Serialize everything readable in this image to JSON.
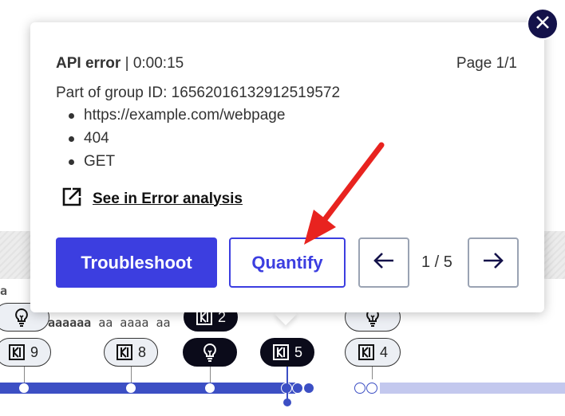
{
  "popup": {
    "error_type": "API error",
    "separator": " | ",
    "duration": "0:00:15",
    "page_indicator": "Page 1/1",
    "group_id": "Part of group ID: 16562016132912519572",
    "details": [
      "https://example.com/webpage",
      "404",
      "GET"
    ],
    "link_label": "See in Error analysis",
    "troubleshoot_label": "Troubleshoot",
    "quantify_label": "Quantify",
    "counter": "1 / 5"
  },
  "background": {
    "text_a": "a",
    "row_text_bold": "aaaaaa",
    "row_text_rest": " aa aaaa aa",
    "pills": [
      {
        "id": "9",
        "label": "9",
        "icon": "frames-icon",
        "dark": false
      },
      {
        "id": "8",
        "label": "8",
        "icon": "frames-icon",
        "dark": false
      },
      {
        "id": "bulb-dark",
        "label": "",
        "icon": "lightbulb-icon",
        "dark": true
      },
      {
        "id": "5",
        "label": "5",
        "icon": "frames-icon",
        "dark": true
      },
      {
        "id": "4",
        "label": "4",
        "icon": "frames-icon",
        "dark": false
      },
      {
        "id": "2",
        "label": "2",
        "icon": "frames-icon",
        "dark": true
      },
      {
        "id": "bulb-left",
        "label": "",
        "icon": "lightbulb-icon",
        "dark": false
      },
      {
        "id": "bulb-right",
        "label": "",
        "icon": "lightbulb-icon",
        "dark": false
      }
    ]
  },
  "colors": {
    "primary": "#3c3ee0",
    "close_bg": "#14124a",
    "timeline_fill": "#3c4fc4",
    "timeline_track": "#c3c8ee",
    "annotation_arrow": "#e8231f"
  }
}
